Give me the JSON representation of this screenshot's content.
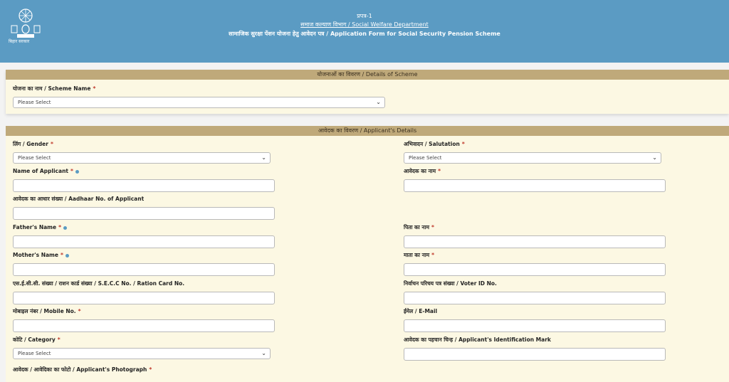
{
  "header": {
    "form_no": "प्रपत्र-1",
    "department": "समाज कल्याण विभाग / Social Welfare Department",
    "form_title": "सामाजिक सुरक्षा पेंशन योजना हेतु आवेदन पत्र / Application Form for Social Security Pension Scheme",
    "logo_text": "बिहार सरकार",
    "logo_icon": "bihar-emblem-icon"
  },
  "scheme_section": {
    "title": "योजनाओं का विवरण / Details of Scheme",
    "scheme_label": "योजना का नाम / Scheme Name",
    "scheme_value": "Please Select"
  },
  "applicant_section": {
    "title": "आवेदक का विवरण / Applicant's Details",
    "gender_label": "लिंग / Gender",
    "gender_value": "Please Select",
    "salutation_label": "अभिवादन / Salutation",
    "salutation_value": "Please Select",
    "name_label": "Name of Applicant",
    "name_hi_label": "आवेदक का नाम",
    "aadhaar_label": "आवेदक का आधार संख्या / Aadhaar No. of Applicant",
    "father_label": "Father's Name",
    "father_hi_label": "पिता का नाम",
    "mother_label": "Mother's Name",
    "mother_hi_label": "माता का नाम",
    "secc_label": "एस.ई.सी.सी. संख्या / राशन कार्ड संख्या / S.E.C.C No. / Ration Card No.",
    "voter_label": "निर्वाचन परिचय पत्र संख्या / Voter ID No.",
    "mobile_label": "मोबाइल नंबर / Mobile No.",
    "email_label": "ईमेल / E-Mail",
    "category_label": "कोटि / Category",
    "category_value": "Please Select",
    "id_mark_label": "आवेदक का पहचान चिन्ह / Applicant's Identification Mark",
    "photo_label": "आवेदक / आवेदिका का फोटो / Applicant's Photograph"
  },
  "required_mark": "*",
  "colors": {
    "header_bg": "#5b9bc3",
    "section_head_bg": "#bfa97a",
    "panel_bg": "#fcf8e3",
    "required": "#c0392b"
  }
}
